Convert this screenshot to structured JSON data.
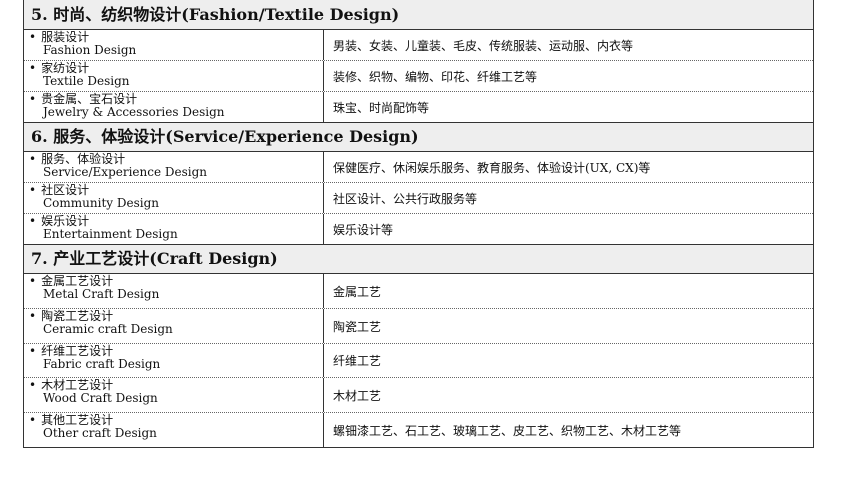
{
  "sections": [
    {
      "title": "5. 时尚、纺织物设计(Fashion/Textile Design)",
      "rows": [
        {
          "zh": "服装设计",
          "en": "Fashion Design",
          "desc": "男装、女装、儿童装、毛皮、传统服装、运动服、内衣等"
        },
        {
          "zh": "家纺设计",
          "en": "Textile Design",
          "desc": "装修、织物、编物、印花、纤维工艺等"
        },
        {
          "zh": "贵金属、宝石设计",
          "en": "Jewelry & Accessories Design",
          "desc": "珠宝、时尚配饰等"
        }
      ]
    },
    {
      "title": "6. 服务、体验设计(Service/Experience Design)",
      "rows": [
        {
          "zh": "服务、体验设计",
          "en": "Service/Experience Design",
          "desc": "保健医疗、休闲娱乐服务、教育服务、体验设计(UX, CX)等"
        },
        {
          "zh": "社区设计",
          "en": "Community Design",
          "desc": "社区设计、公共行政服务等"
        },
        {
          "zh": "娱乐设计",
          "en": "Entertainment Design",
          "desc": "娱乐设计等"
        }
      ]
    },
    {
      "title": "7. 产业工艺设计(Craft Design)",
      "rows": [
        {
          "zh": "金属工艺设计",
          "en": "Metal Craft Design",
          "desc": "金属工艺"
        },
        {
          "zh": "陶瓷工艺设计",
          "en": "Ceramic craft Design",
          "desc": "陶瓷工艺"
        },
        {
          "zh": "纤维工艺设计",
          "en": "Fabric craft Design",
          "desc": "纤维工艺"
        },
        {
          "zh": "木材工艺设计",
          "en": "Wood Craft Design",
          "desc": "木材工艺"
        },
        {
          "zh": "其他工艺设计",
          "en": "Other craft Design",
          "desc": "螺钿漆工艺、石工艺、玻璃工艺、皮工艺、织物工艺、木材工艺等"
        }
      ]
    }
  ]
}
